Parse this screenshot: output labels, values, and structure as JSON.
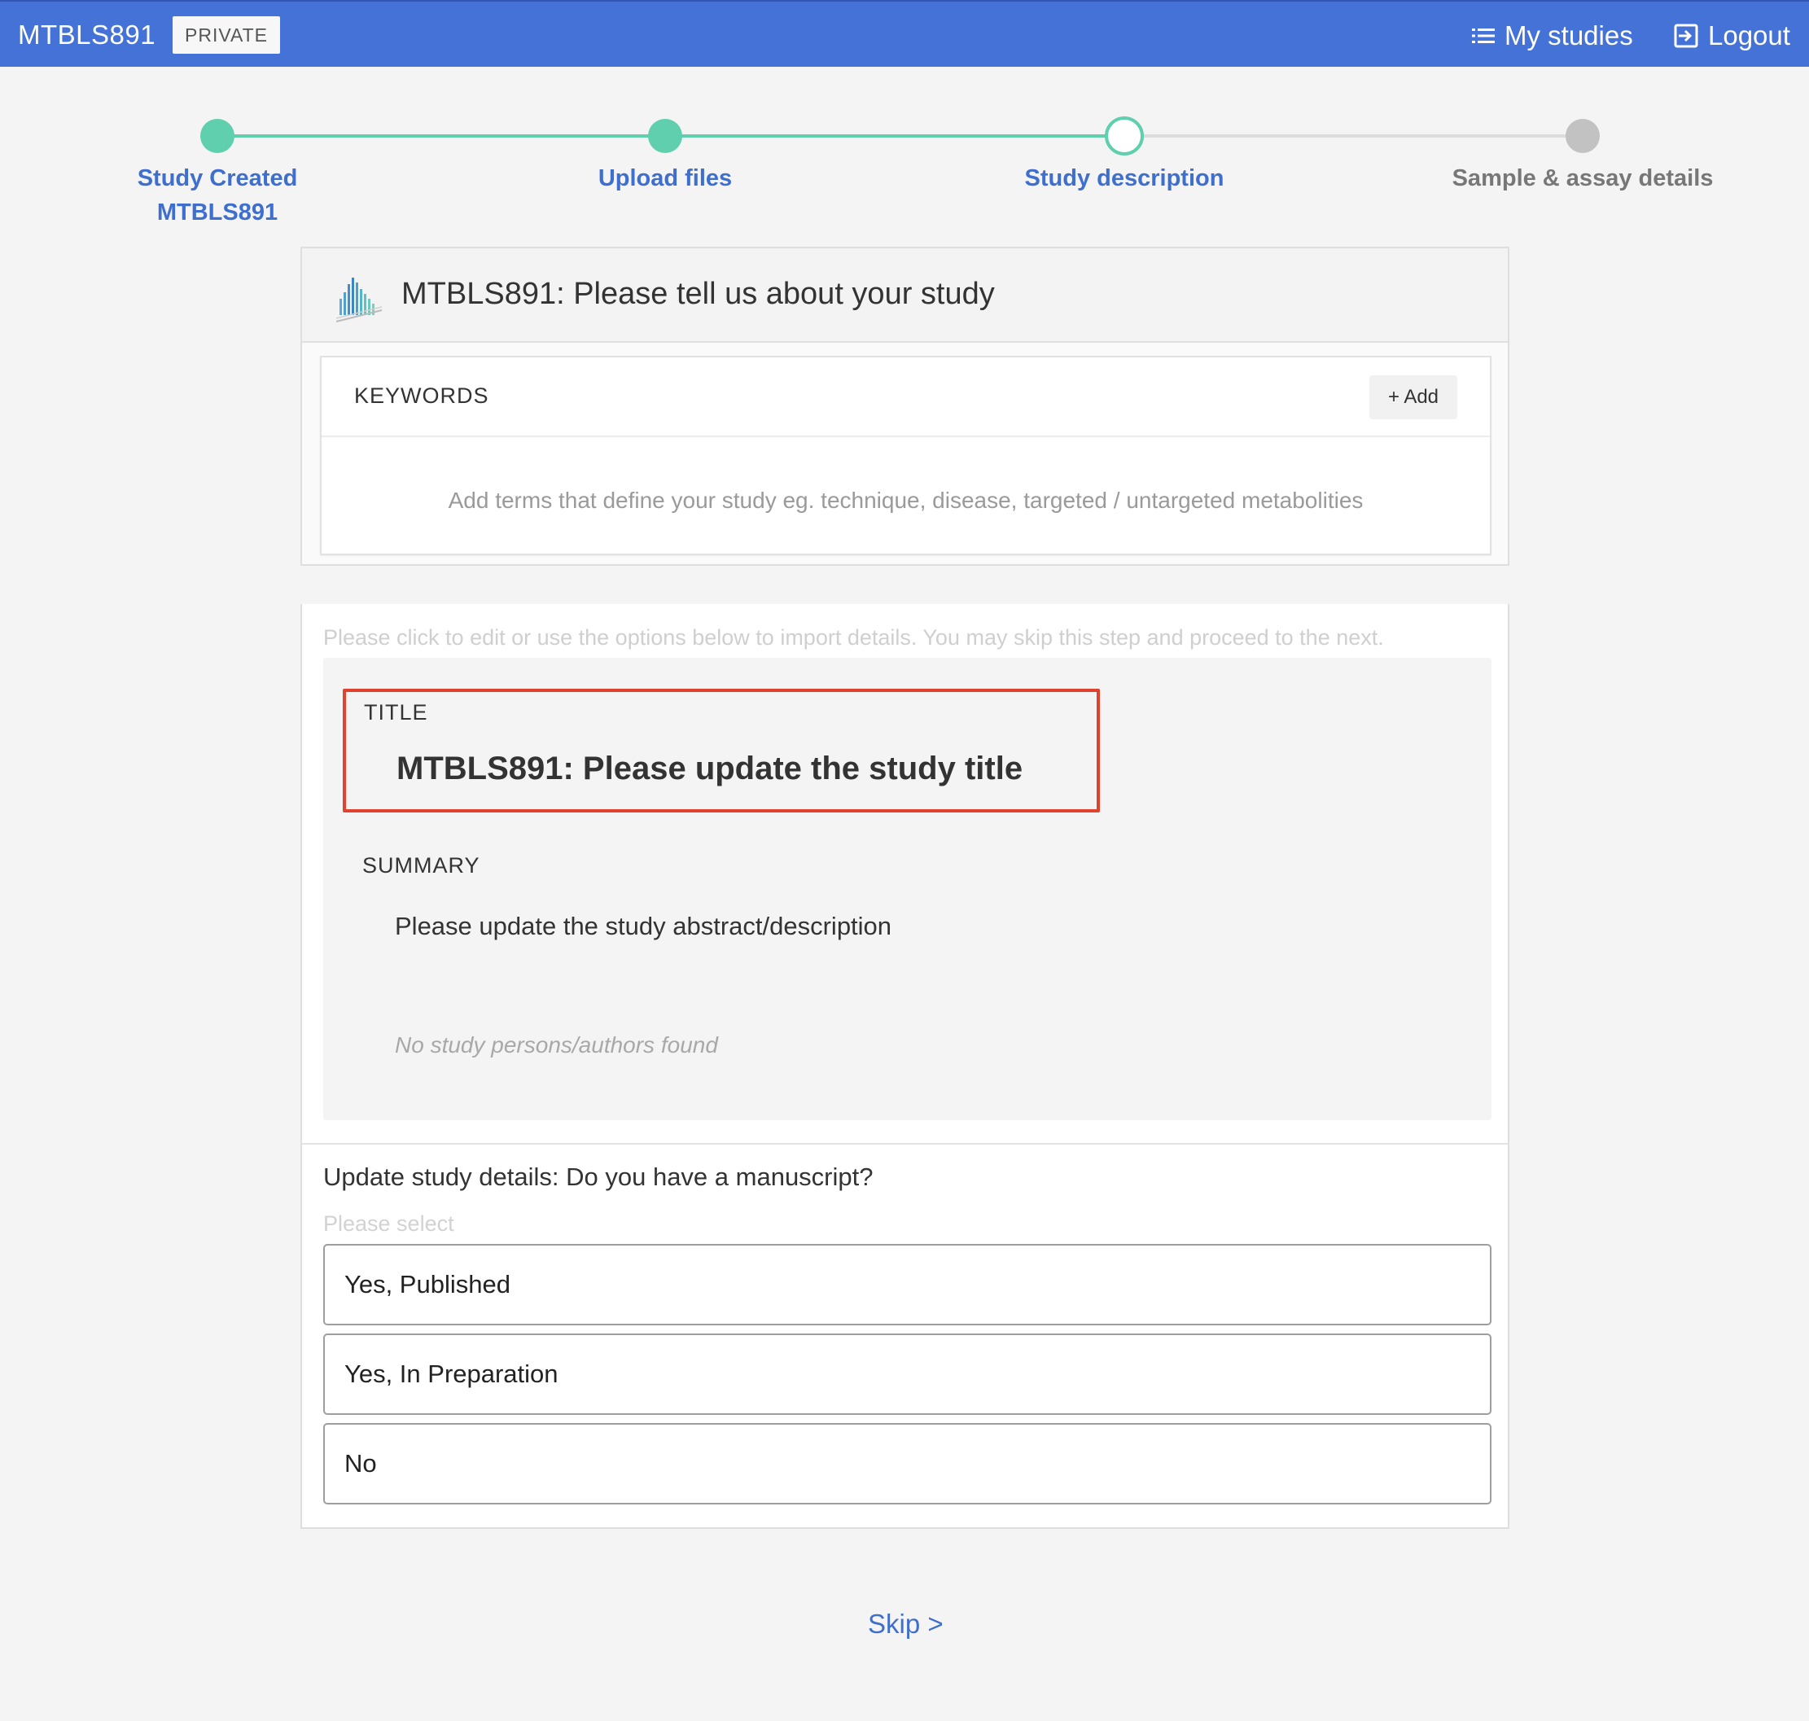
{
  "header": {
    "brand": "MTBLS891",
    "badge": "PRIVATE",
    "nav": {
      "my_studies": "My studies",
      "logout": "Logout"
    }
  },
  "stepper": {
    "steps": [
      {
        "label": "Study Created",
        "sublabel": "MTBLS891",
        "state": "done"
      },
      {
        "label": "Upload files",
        "state": "done"
      },
      {
        "label": "Study description",
        "state": "current"
      },
      {
        "label": "Sample & assay details",
        "state": "todo"
      }
    ],
    "colors": {
      "done": "#5fcfae",
      "todo": "#c2c2c2",
      "label_active": "#3e6fce",
      "label_inactive": "#777777"
    }
  },
  "intro_card": {
    "title": "MTBLS891: Please tell us about your study",
    "keywords": {
      "label": "KEYWORDS",
      "add_button": "+ Add",
      "hint": "Add terms that define your study eg. technique, disease, targeted / untargeted metabolities"
    }
  },
  "details_card": {
    "hint": "Please click to edit or use the options below to import details. You may skip this step and proceed to the next.",
    "title_label": "TITLE",
    "title_value": "MTBLS891: Please update the study title",
    "summary_label": "SUMMARY",
    "summary_value": "Please update the study abstract/description",
    "persons_value": "No study persons/authors found",
    "highlight_color": "#e0422f"
  },
  "manuscript": {
    "question": "Update study details: Do you have a manuscript?",
    "select_hint": "Please select",
    "options": [
      "Yes, Published",
      "Yes, In Preparation",
      "No"
    ]
  },
  "footer": {
    "skip": "Skip >"
  },
  "theme": {
    "topbar": "#4472d6",
    "link": "#3e6fce"
  }
}
